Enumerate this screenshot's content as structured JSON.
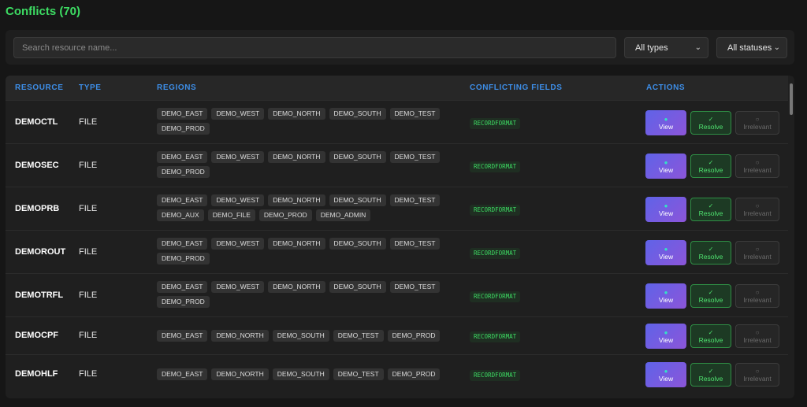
{
  "title": "Conflicts (70)",
  "filters": {
    "search_placeholder": "Search resource name...",
    "type_select": "All types",
    "status_select": "All statuses"
  },
  "columns": [
    "RESOURCE",
    "TYPE",
    "REGIONS",
    "CONFLICTING FIELDS",
    "ACTIONS"
  ],
  "actions": {
    "view": "View",
    "resolve": "Resolve",
    "irrelevant": "Irrelevant"
  },
  "icons": {
    "view": "dot-icon",
    "resolve": "check-icon",
    "irrelevant": "circle-icon"
  },
  "colors": {
    "title": "#3ddc63",
    "header": "#3d8de6",
    "field": "#3ddc63",
    "view_button": "#6b5fe4",
    "resolve_button": "#2f8f45"
  },
  "rows": [
    {
      "resource": "DEMOCTL",
      "type": "FILE",
      "regions": [
        "DEMO_EAST",
        "DEMO_WEST",
        "DEMO_NORTH",
        "DEMO_SOUTH",
        "DEMO_TEST",
        "DEMO_PROD"
      ],
      "fields": [
        "RECORDFORMAT"
      ]
    },
    {
      "resource": "DEMOSEC",
      "type": "FILE",
      "regions": [
        "DEMO_EAST",
        "DEMO_WEST",
        "DEMO_NORTH",
        "DEMO_SOUTH",
        "DEMO_TEST",
        "DEMO_PROD"
      ],
      "fields": [
        "RECORDFORMAT"
      ]
    },
    {
      "resource": "DEMOPRB",
      "type": "FILE",
      "regions": [
        "DEMO_EAST",
        "DEMO_WEST",
        "DEMO_NORTH",
        "DEMO_SOUTH",
        "DEMO_TEST",
        "DEMO_AUX",
        "DEMO_FILE",
        "DEMO_PROD",
        "DEMO_ADMIN"
      ],
      "fields": [
        "RECORDFORMAT"
      ]
    },
    {
      "resource": "DEMOROUT",
      "type": "FILE",
      "regions": [
        "DEMO_EAST",
        "DEMO_WEST",
        "DEMO_NORTH",
        "DEMO_SOUTH",
        "DEMO_TEST",
        "DEMO_PROD"
      ],
      "fields": [
        "RECORDFORMAT"
      ]
    },
    {
      "resource": "DEMOTRFL",
      "type": "FILE",
      "regions": [
        "DEMO_EAST",
        "DEMO_WEST",
        "DEMO_NORTH",
        "DEMO_SOUTH",
        "DEMO_TEST",
        "DEMO_PROD"
      ],
      "fields": [
        "RECORDFORMAT"
      ]
    },
    {
      "resource": "DEMOCPF",
      "type": "FILE",
      "regions": [
        "DEMO_EAST",
        "DEMO_NORTH",
        "DEMO_SOUTH",
        "DEMO_TEST",
        "DEMO_PROD"
      ],
      "fields": [
        "RECORDFORMAT"
      ]
    },
    {
      "resource": "DEMOHLF",
      "type": "FILE",
      "regions": [
        "DEMO_EAST",
        "DEMO_NORTH",
        "DEMO_SOUTH",
        "DEMO_TEST",
        "DEMO_PROD"
      ],
      "fields": [
        "RECORDFORMAT"
      ]
    }
  ]
}
